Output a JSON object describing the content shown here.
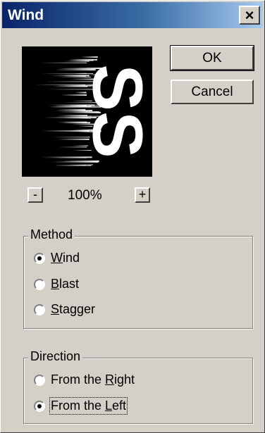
{
  "window": {
    "title": "Wind",
    "close_glyph": "×"
  },
  "preview": {
    "sample_text": "SS"
  },
  "buttons": {
    "ok_label": "OK",
    "cancel_label": "Cancel"
  },
  "zoom": {
    "minus_label": "-",
    "plus_label": "+",
    "level": "100%"
  },
  "method": {
    "title": "Method",
    "options": [
      {
        "label": "Wind",
        "mnemonic": "W",
        "rest": "ind",
        "checked": true
      },
      {
        "label": "Blast",
        "mnemonic": "B",
        "rest": "last",
        "checked": false
      },
      {
        "label": "Stagger",
        "mnemonic": "S",
        "rest": "tagger",
        "checked": false
      }
    ]
  },
  "direction": {
    "title": "Direction",
    "options": [
      {
        "label": "From the Right",
        "prefix": "From the ",
        "mnemonic": "R",
        "rest": "ight",
        "checked": false
      },
      {
        "label": "From the Left",
        "prefix": "From the ",
        "mnemonic": "L",
        "rest": "eft",
        "checked": true
      }
    ]
  }
}
